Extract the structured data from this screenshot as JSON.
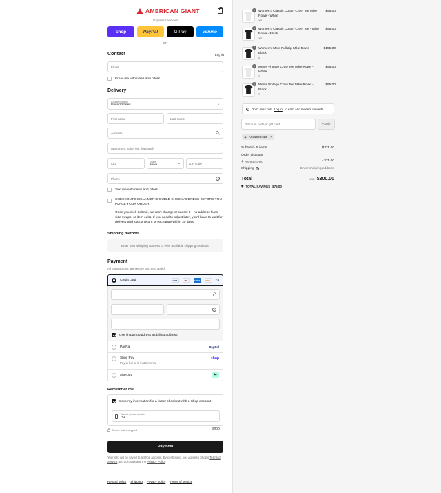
{
  "brand": {
    "name": "AMERICAN GIANT",
    "color": "#d7282f"
  },
  "express": {
    "label": "Express checkout",
    "buttons": [
      {
        "label": "shop",
        "bg": "#5a31f4",
        "fg": "#ffffff"
      },
      {
        "label": "PayPal",
        "bg": "#ffc439",
        "fg": "#253b80"
      },
      {
        "label": "G Pay",
        "bg": "#000000",
        "fg": "#ffffff"
      },
      {
        "label": "venmo",
        "bg": "#008cff",
        "fg": "#ffffff"
      }
    ],
    "or": "OR"
  },
  "contact": {
    "title": "Contact",
    "login": "Log in",
    "email_placeholder": "Email",
    "news_label": "Email me with news and offers"
  },
  "delivery": {
    "title": "Delivery",
    "country_label": "Country/Region",
    "country_value": "United States",
    "first_name": "First name",
    "last_name": "Last name",
    "address": "Address",
    "apartment": "Apartment, suite, etc. (optional)",
    "city": "City",
    "state_label": "State",
    "state_value": "Iowa",
    "zip": "ZIP code",
    "phone": "Phone",
    "text_label": "Text me with news and offers",
    "disclaimer_title": "CHECKOUT DISCLAIMER: DOUBLE CHECK ADDRESS BEFORE YOU PLACE YOUR ORDER",
    "disclaimer_body": "Once you click Submit, we can't change or cancel it—no address fixes, size swaps, or item edits. If you need to adjust later, you'll have to wait for delivery and start a return or exchange within 30 days."
  },
  "shipping": {
    "title": "Shipping method",
    "message": "Enter your shipping address to view available shipping methods."
  },
  "payment": {
    "title": "Payment",
    "subtitle": "All transactions are secure and encrypted.",
    "credit_card": "Credit card",
    "card_icons": [
      {
        "label": "VISA",
        "bg": "#ffffff",
        "fg": "#1a1f71"
      },
      {
        "label": "MC",
        "bg": "#ffffff",
        "fg": "#eb001b"
      },
      {
        "label": "AMEX",
        "bg": "#1f72cd",
        "fg": "#ffffff"
      },
      {
        "label": "DISC",
        "bg": "#ffffff",
        "fg": "#f48120"
      }
    ],
    "more_cards": "+4",
    "billing_label": "Use shipping address as billing address",
    "paypal": "PayPal",
    "paypal_logo": "PayPal",
    "shoppay": "Shop Pay",
    "shoppay_sub": "Pay in full or in installments",
    "shoppay_logo": "shop",
    "afterpay": "Afterpay"
  },
  "remember": {
    "title": "Remember me",
    "save_label": "Save my information for a faster checkout with a Shop account",
    "mobile_label": "Mobile phone number",
    "mobile_value": "+1",
    "secure": "Secure and encrypted",
    "shop_logo": "shop"
  },
  "pay_now": "Pay now",
  "legal": {
    "text1": "Your info will be saved to a Shop account. By continuing, you agree to Shop's",
    "terms": "Terms of Service",
    "text2": "and acknowledge the",
    "privacy": "Privacy Policy",
    "end": "."
  },
  "footer": [
    "Refund policy",
    "Shipping",
    "Privacy policy",
    "Terms of service"
  ],
  "cart": {
    "items": [
      {
        "name": "Women's Classic Cotton Crew Tee Mike Rowe - White",
        "variant": "XS",
        "price": "$55.00",
        "qty": "1",
        "color": "white"
      },
      {
        "name": "Women's Classic Cotton Crew Tee - Mike Rowe - Black",
        "variant": "XS",
        "price": "$55.00",
        "qty": "1",
        "color": "black"
      },
      {
        "name": "Women's Moto Full Zip Mike Rowe - Black",
        "variant": "M",
        "price": "$155.00",
        "qty": "1",
        "color": "black"
      },
      {
        "name": "Men's Vintage Crew Tee Mike Rowe - White",
        "variant": "S",
        "price": "$55.00",
        "qty": "1",
        "color": "white"
      },
      {
        "name": "Men's Vintage Crew Tee Mike Rowe - Black",
        "variant": "S",
        "price": "$55.00",
        "qty": "1",
        "color": "black"
      }
    ],
    "rewards_text": "Don't miss out!",
    "rewards_link": "Log in",
    "rewards_tail": "to earn and redeem rewards",
    "discount_placeholder": "Discount code or gift card",
    "apply": "Apply",
    "code": "ASHLEIGH20",
    "subtotal_label": "Subtotal · 5 items",
    "subtotal": "$375.00",
    "order_discount_label": "Order discount",
    "discount_code": "ASHLEIGH20",
    "discount_value": "- $75.00",
    "shipping_label": "Shipping",
    "shipping_value": "Enter shipping address",
    "total_label": "Total",
    "currency": "USD",
    "total": "$300.00",
    "savings_label": "TOTAL SAVINGS",
    "savings": "$75.00"
  }
}
